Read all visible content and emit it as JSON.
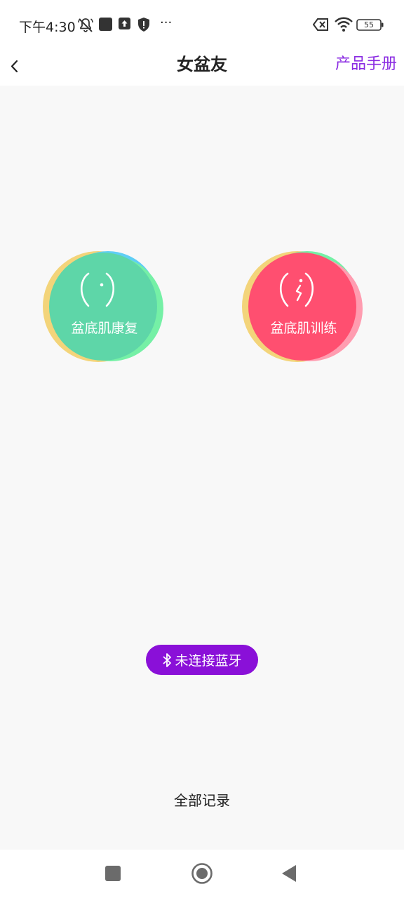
{
  "status_bar": {
    "time": "下午4:30",
    "more": "···",
    "battery": "55"
  },
  "header": {
    "title": "女盆友",
    "manual_label": "产品手册"
  },
  "main": {
    "recovery_label": "盆底肌康复",
    "training_label": "盆底肌训练",
    "bluetooth_status": "未连接蓝牙",
    "all_records_label": "全部记录"
  },
  "colors": {
    "accent": "#8a2be2",
    "bt_pill": "#8a10d8",
    "recovery_main": "#5ed6a8",
    "training_main": "#ff4f70"
  },
  "icons": {
    "back": "chevron-left-icon",
    "bluetooth": "bluetooth-icon",
    "recovery": "belly-icon",
    "training": "belly-pain-icon",
    "nav_recents": "square-icon",
    "nav_home": "circle-icon",
    "nav_back": "triangle-left-icon"
  }
}
